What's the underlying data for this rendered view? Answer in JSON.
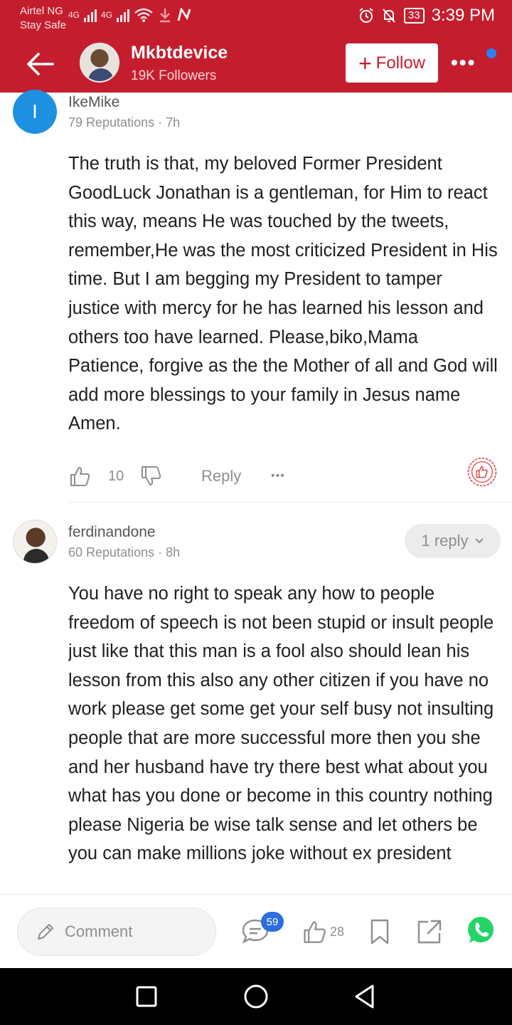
{
  "status_bar": {
    "carrier": "Airtel NG",
    "carrier_sub": "Stay Safe",
    "net1": "4G",
    "net2": "4G",
    "battery": "33",
    "time": "3:39 PM"
  },
  "header": {
    "author": "Mkbtdevice",
    "followers": "19K Followers",
    "follow_label": "Follow",
    "more_label": "•••"
  },
  "comments": [
    {
      "avatar_letter": "I",
      "username": "IkeMike",
      "meta": "79 Reputations · 7h",
      "text": "The truth is that, my beloved Former President GoodLuck Jonathan is a gentleman, for Him to react this way, means He was touched by the tweets, remember,He was the most criticized President in His time. But  I am begging my President to tamper justice with mercy for he has learned his lesson and others too have learned. Please,biko,Mama Patience, forgive as the the Mother of all and God will add more blessings to your family in Jesus name Amen.",
      "likes": "10",
      "reply_label": "Reply",
      "more_label": "•••"
    },
    {
      "username": "ferdinandone",
      "meta": "60 Reputations · 8h",
      "replies_label": "1 reply",
      "text": "You have no right to speak any how to people freedom of speech is not been stupid or insult people just like that this man is a fool also should lean his lesson from this also any other citizen if you have no work please get some get your self busy not insulting people that are more successful more then you she and her husband have try there best what about you what has you done or become in this country nothing please Nigeria be wise talk sense and let others be you can make millions joke without ex president"
    }
  ],
  "bottom_bar": {
    "comment_placeholder": "Comment",
    "comment_count": "59",
    "like_count": "28"
  },
  "colors": {
    "brand_red": "#c41e2e",
    "avatar_blue": "#1e90e0",
    "badge_blue": "#2d6de0",
    "whatsapp_green": "#25d366"
  }
}
